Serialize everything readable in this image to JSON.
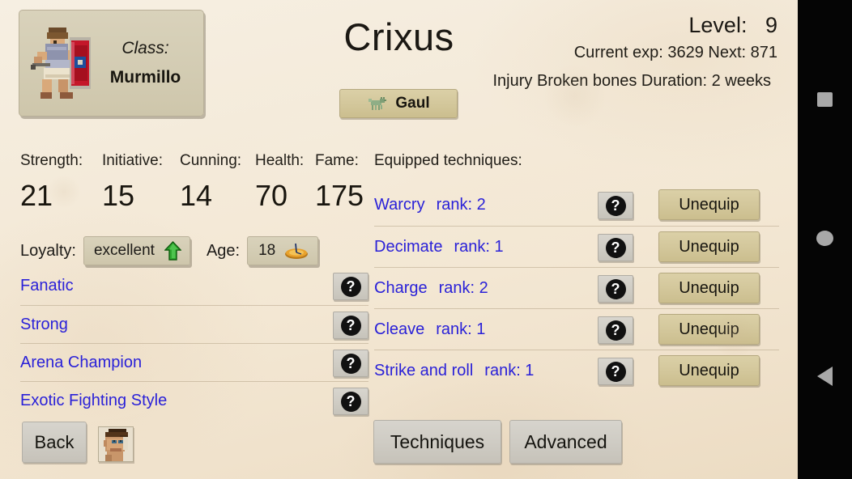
{
  "character": {
    "name": "Crixus",
    "class_label": "Class:",
    "class_value": "Murmillo",
    "origin": "Gaul",
    "origin_icon": "boar-icon",
    "level_label": "Level:",
    "level_value": "9",
    "exp_text": "Current exp: 3629 Next: 871",
    "injury_text": "Injury  Broken bones  Duration: 2 weeks"
  },
  "stats": [
    {
      "name": "Strength:",
      "value": "21"
    },
    {
      "name": "Initiative:",
      "value": "15"
    },
    {
      "name": "Cunning:",
      "value": "14"
    },
    {
      "name": "Health:",
      "value": "70"
    },
    {
      "name": "Fame:",
      "value": "175"
    }
  ],
  "loyalty": {
    "label": "Loyalty:",
    "value": "excellent",
    "trend_icon": "arrow-up-icon"
  },
  "age": {
    "label": "Age:",
    "value": "18",
    "icon": "sundial-icon"
  },
  "traits": [
    {
      "name": "Fanatic",
      "help": "?"
    },
    {
      "name": "Strong",
      "help": "?"
    },
    {
      "name": "Arena Champion",
      "help": "?"
    },
    {
      "name": "Exotic Fighting Style",
      "help": "?"
    }
  ],
  "techniques": {
    "header": "Equipped techniques:",
    "unequip_label": "Unequip",
    "help_label": "?",
    "items": [
      {
        "name": "Warcry",
        "rank": "rank: 2"
      },
      {
        "name": "Decimate",
        "rank": "rank: 1"
      },
      {
        "name": "Charge",
        "rank": "rank: 2"
      },
      {
        "name": "Cleave",
        "rank": "rank: 1"
      },
      {
        "name": "Strike and roll",
        "rank": "rank: 1"
      }
    ]
  },
  "footer": {
    "back": "Back",
    "portrait_icon": "gladiator-portrait-icon",
    "techniques": "Techniques",
    "advanced": "Advanced"
  },
  "navbar": {
    "recent_icon": "square-recents-icon",
    "home_icon": "circle-home-icon",
    "back_icon": "triangle-back-icon"
  },
  "colors": {
    "parchment": "#f4ead9",
    "link_blue": "#2a21d8",
    "tan_button": "#d3c79b",
    "gray_button": "#cecbc3",
    "loyalty_green": "#2fa82f"
  }
}
